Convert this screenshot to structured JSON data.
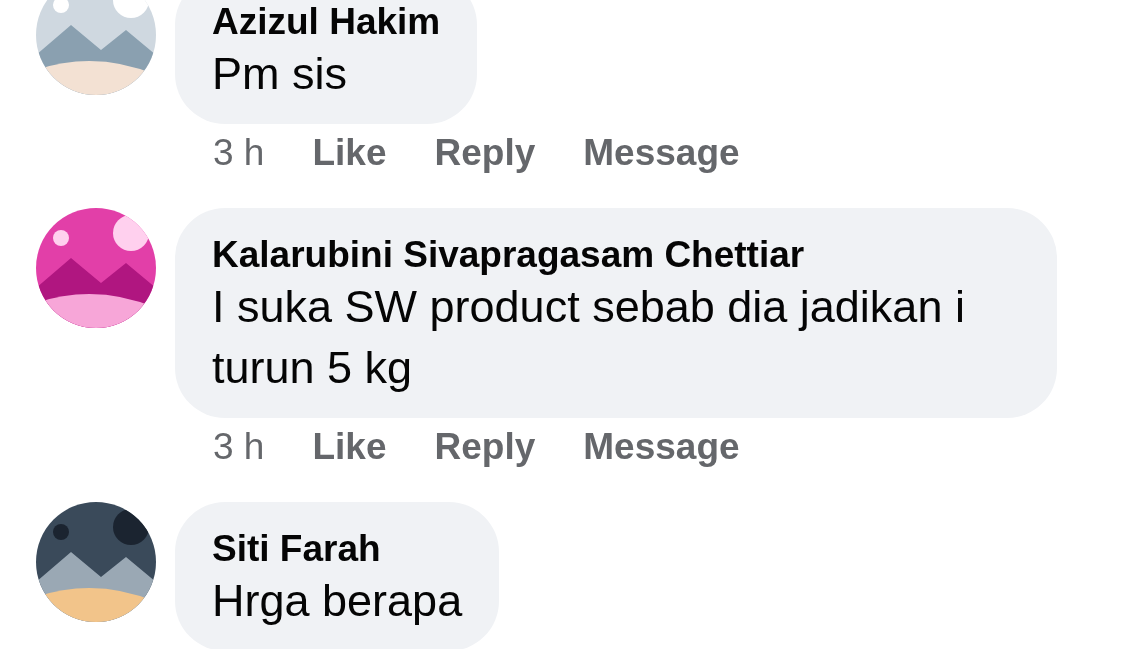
{
  "comments": [
    {
      "author": "Azizul Hakim",
      "text": "Pm sis",
      "time": "3 h",
      "actions": [
        "Like",
        "Reply",
        "Message"
      ]
    },
    {
      "author": "Kalarubini Sivapragasam Chettiar",
      "text": "I suka SW product sebab dia jadikan i turun 5 kg",
      "time": "3 h",
      "actions": [
        "Like",
        "Reply",
        "Message"
      ]
    },
    {
      "author": "Siti Farah",
      "text": "Hrga berapa"
    }
  ]
}
